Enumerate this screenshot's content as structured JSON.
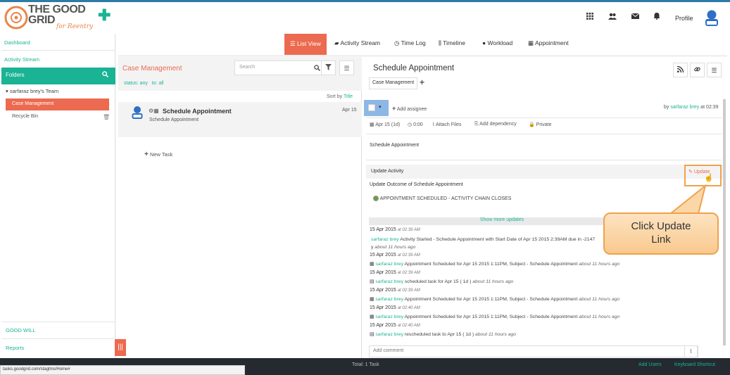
{
  "brand": {
    "line1": "THE GOOD",
    "line2": "GRID",
    "tagline": "for Reentry"
  },
  "header": {
    "profile_label": "Profile"
  },
  "sidebar": {
    "dashboard": "Dashboard",
    "activity_stream": "Activity Stream",
    "folders": "Folders",
    "team": "sarfaraz brey's Team",
    "case_management": "Case Management",
    "recycle_bin": "Recycle Bin",
    "good_will": "GOOD WILL",
    "reports": "Reports"
  },
  "tabs": {
    "list_view": "List View",
    "activity_stream": "Activity Stream",
    "time_log": "Time Log",
    "timeline": "Timeline",
    "workload": "Workload",
    "appointment": "Appointment"
  },
  "list": {
    "title": "Case Management",
    "status_prefix": "status:",
    "status_value": "any",
    "to_prefix": "to:",
    "to_value": "all",
    "search_placeholder": "Search",
    "sort_prefix": "Sort by",
    "sort_value": "Title",
    "task_title": "Schedule Appointment",
    "task_sub": "Schedule Appointment",
    "task_date": "Apr 15",
    "new_task": "New Task"
  },
  "detail": {
    "title": "Schedule Appointment",
    "tag": "Case Management",
    "add_assignee": "Add assignee",
    "by_prefix": "by",
    "by_user": "sarfaraz brey",
    "by_time": "at 02:39",
    "due": "Apr 15 (1d)",
    "time": "0:00",
    "attach": "Attach Files",
    "dependency": "Add dependency",
    "private": "Private",
    "description": "Schedule Appointment",
    "update_activity": "Update Activity",
    "update_link": "Update",
    "outcome_heading": "Update Outcome of Schedule Appointment",
    "outcome_option": "APPOINTMENT SCHEDULED - ACTIVITY CHAIN CLOSES",
    "show_more": "Show more updates",
    "comment_placeholder": "Add comment"
  },
  "feed": [
    {
      "date": "15 Apr 2015",
      "time": "at 02:39 AM",
      "user": "sarfaraz brey",
      "text": "Activity Started - Schedule Appointment with Start Date of Apr 15 2015 2:39AM due in -2147",
      "text2": "y",
      "ago": "about 11 hours ago"
    },
    {
      "date": "15 Apr 2015",
      "time": "at 02:39 AM",
      "user": "sarfaraz brey",
      "text": "Appointment Scheduled for Apr 15 2015 1:11PM, Subject - Schedule Appointment",
      "ago": "about 11 hours ago"
    },
    {
      "date": "15 Apr 2015",
      "time": "at 02:39 AM",
      "user": "sarfaraz brey",
      "text": "scheduled task for Apr 15 ( 1d )",
      "ago": "about 11 hours ago"
    },
    {
      "date": "15 Apr 2015",
      "time": "at 02:39 AM",
      "user": "sarfaraz brey",
      "text": "Appointment Scheduled for Apr 15 2015 1:11PM, Subject - Schedule Appointment",
      "ago": "about 11 hours ago"
    },
    {
      "date": "15 Apr 2015",
      "time": "at 02:40 AM",
      "user": "sarfaraz brey",
      "text": "Appointment Scheduled for Apr 15 2015 1:11PM, Subject - Schedule Appointment",
      "ago": "about 11 hours ago"
    },
    {
      "date": "15 Apr 2015",
      "time": "at 02:40 AM",
      "user": "sarfaraz brey",
      "text": "rescheduled task to Apr 15 ( 1d )",
      "ago": "about 11 hours ago"
    }
  ],
  "callout": {
    "line1": "Click Update",
    "line2": "Link"
  },
  "footer": {
    "total": "Total: 1 Task",
    "add_users": "Add Users",
    "keyboard": "Keyboard Shortcut",
    "url": "tasks.goodgrid.com/stagtms/Home#"
  },
  "colors": {
    "accent": "#1ab394",
    "active": "#ec6a4f",
    "callout": "#f9c98e"
  }
}
